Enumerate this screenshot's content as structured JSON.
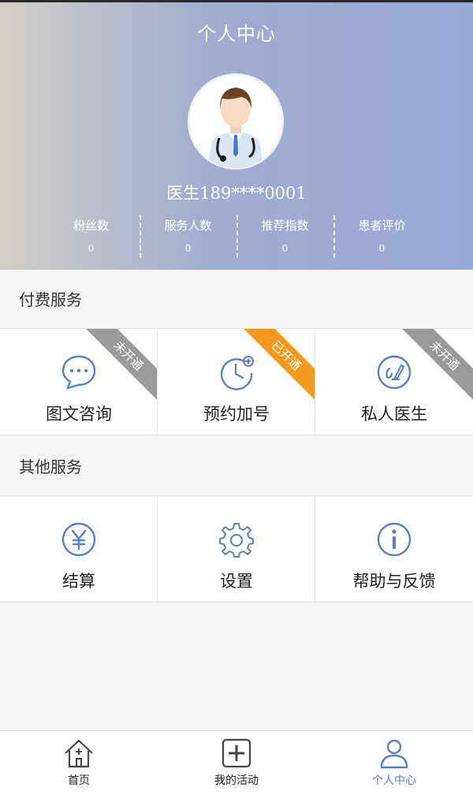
{
  "header": {
    "title": "个人中心",
    "doctor_name": "医生189****0001",
    "stats": [
      {
        "label": "粉丝数",
        "value": "0"
      },
      {
        "label": "服务人数",
        "value": "0"
      },
      {
        "label": "推荐指数",
        "value": "0"
      },
      {
        "label": "患者评价",
        "value": "0"
      }
    ]
  },
  "paid_services": {
    "title": "付费服务",
    "items": [
      {
        "label": "图文咨询",
        "badge": "未开通",
        "icon": "chat-bubble-icon"
      },
      {
        "label": "预约加号",
        "badge": "已开通",
        "icon": "clock-plus-icon"
      },
      {
        "label": "私人医生",
        "badge": "未开通",
        "icon": "doctor-pen-icon"
      }
    ]
  },
  "other_services": {
    "title": "其他服务",
    "items": [
      {
        "label": "结算",
        "icon": "yen-icon"
      },
      {
        "label": "设置",
        "icon": "gear-icon"
      },
      {
        "label": "帮助与反馈",
        "icon": "info-icon"
      }
    ]
  },
  "tabbar": {
    "items": [
      {
        "label": "首页",
        "icon": "home-icon"
      },
      {
        "label": "我的活动",
        "icon": "plus-box-icon"
      },
      {
        "label": "个人中心",
        "icon": "person-icon",
        "active": true
      }
    ]
  },
  "colors": {
    "accent": "#5b7ec6",
    "badge_on": "#f39a1e",
    "badge_off": "#9a9a9a"
  }
}
